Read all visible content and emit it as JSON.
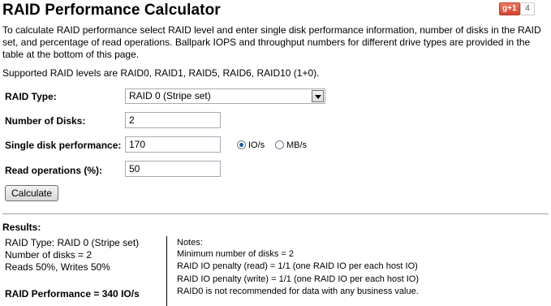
{
  "page": {
    "title": "RAID Performance Calculator",
    "gplus_label": "g+1",
    "gplus_count": "4",
    "intro": "To calculate RAID performance select RAID level and enter single disk performance information, number of disks in the RAID set, and percentage of read operations. Ballpark IOPS and throughput numbers for different drive types are provided in the table at the bottom of this page.",
    "supported": "Supported RAID levels are RAID0, RAID1, RAID5, RAID6, RAID10 (1+0)."
  },
  "form": {
    "raid_type_label": "RAID Type:",
    "raid_type_value": "RAID 0 (Stripe set)",
    "disks_label": "Number of Disks:",
    "disks_value": "2",
    "perf_label": "Single disk performance:",
    "perf_value": "170",
    "unit_iops": "IO/s",
    "unit_mbs": "MB/s",
    "unit_selected": "IO/s",
    "reads_label": "Read operations (%):",
    "reads_value": "50",
    "calculate_label": "Calculate"
  },
  "results": {
    "heading": "Results:",
    "lines": [
      "RAID Type: RAID 0 (Stripe set)",
      "Number of disks = 2",
      "Reads 50%, Writes 50%"
    ],
    "performance": "RAID Performance = 340 IO/s",
    "notes_heading": "Notes:",
    "notes": [
      "Minimum number of disks = 2",
      "RAID IO penalty (read) = 1/1 (one RAID IO per each host IO)",
      "RAID IO penalty (write) = 1/1 (one RAID IO per each host IO)",
      "RAID0 is not recommended for data with any business value."
    ]
  }
}
